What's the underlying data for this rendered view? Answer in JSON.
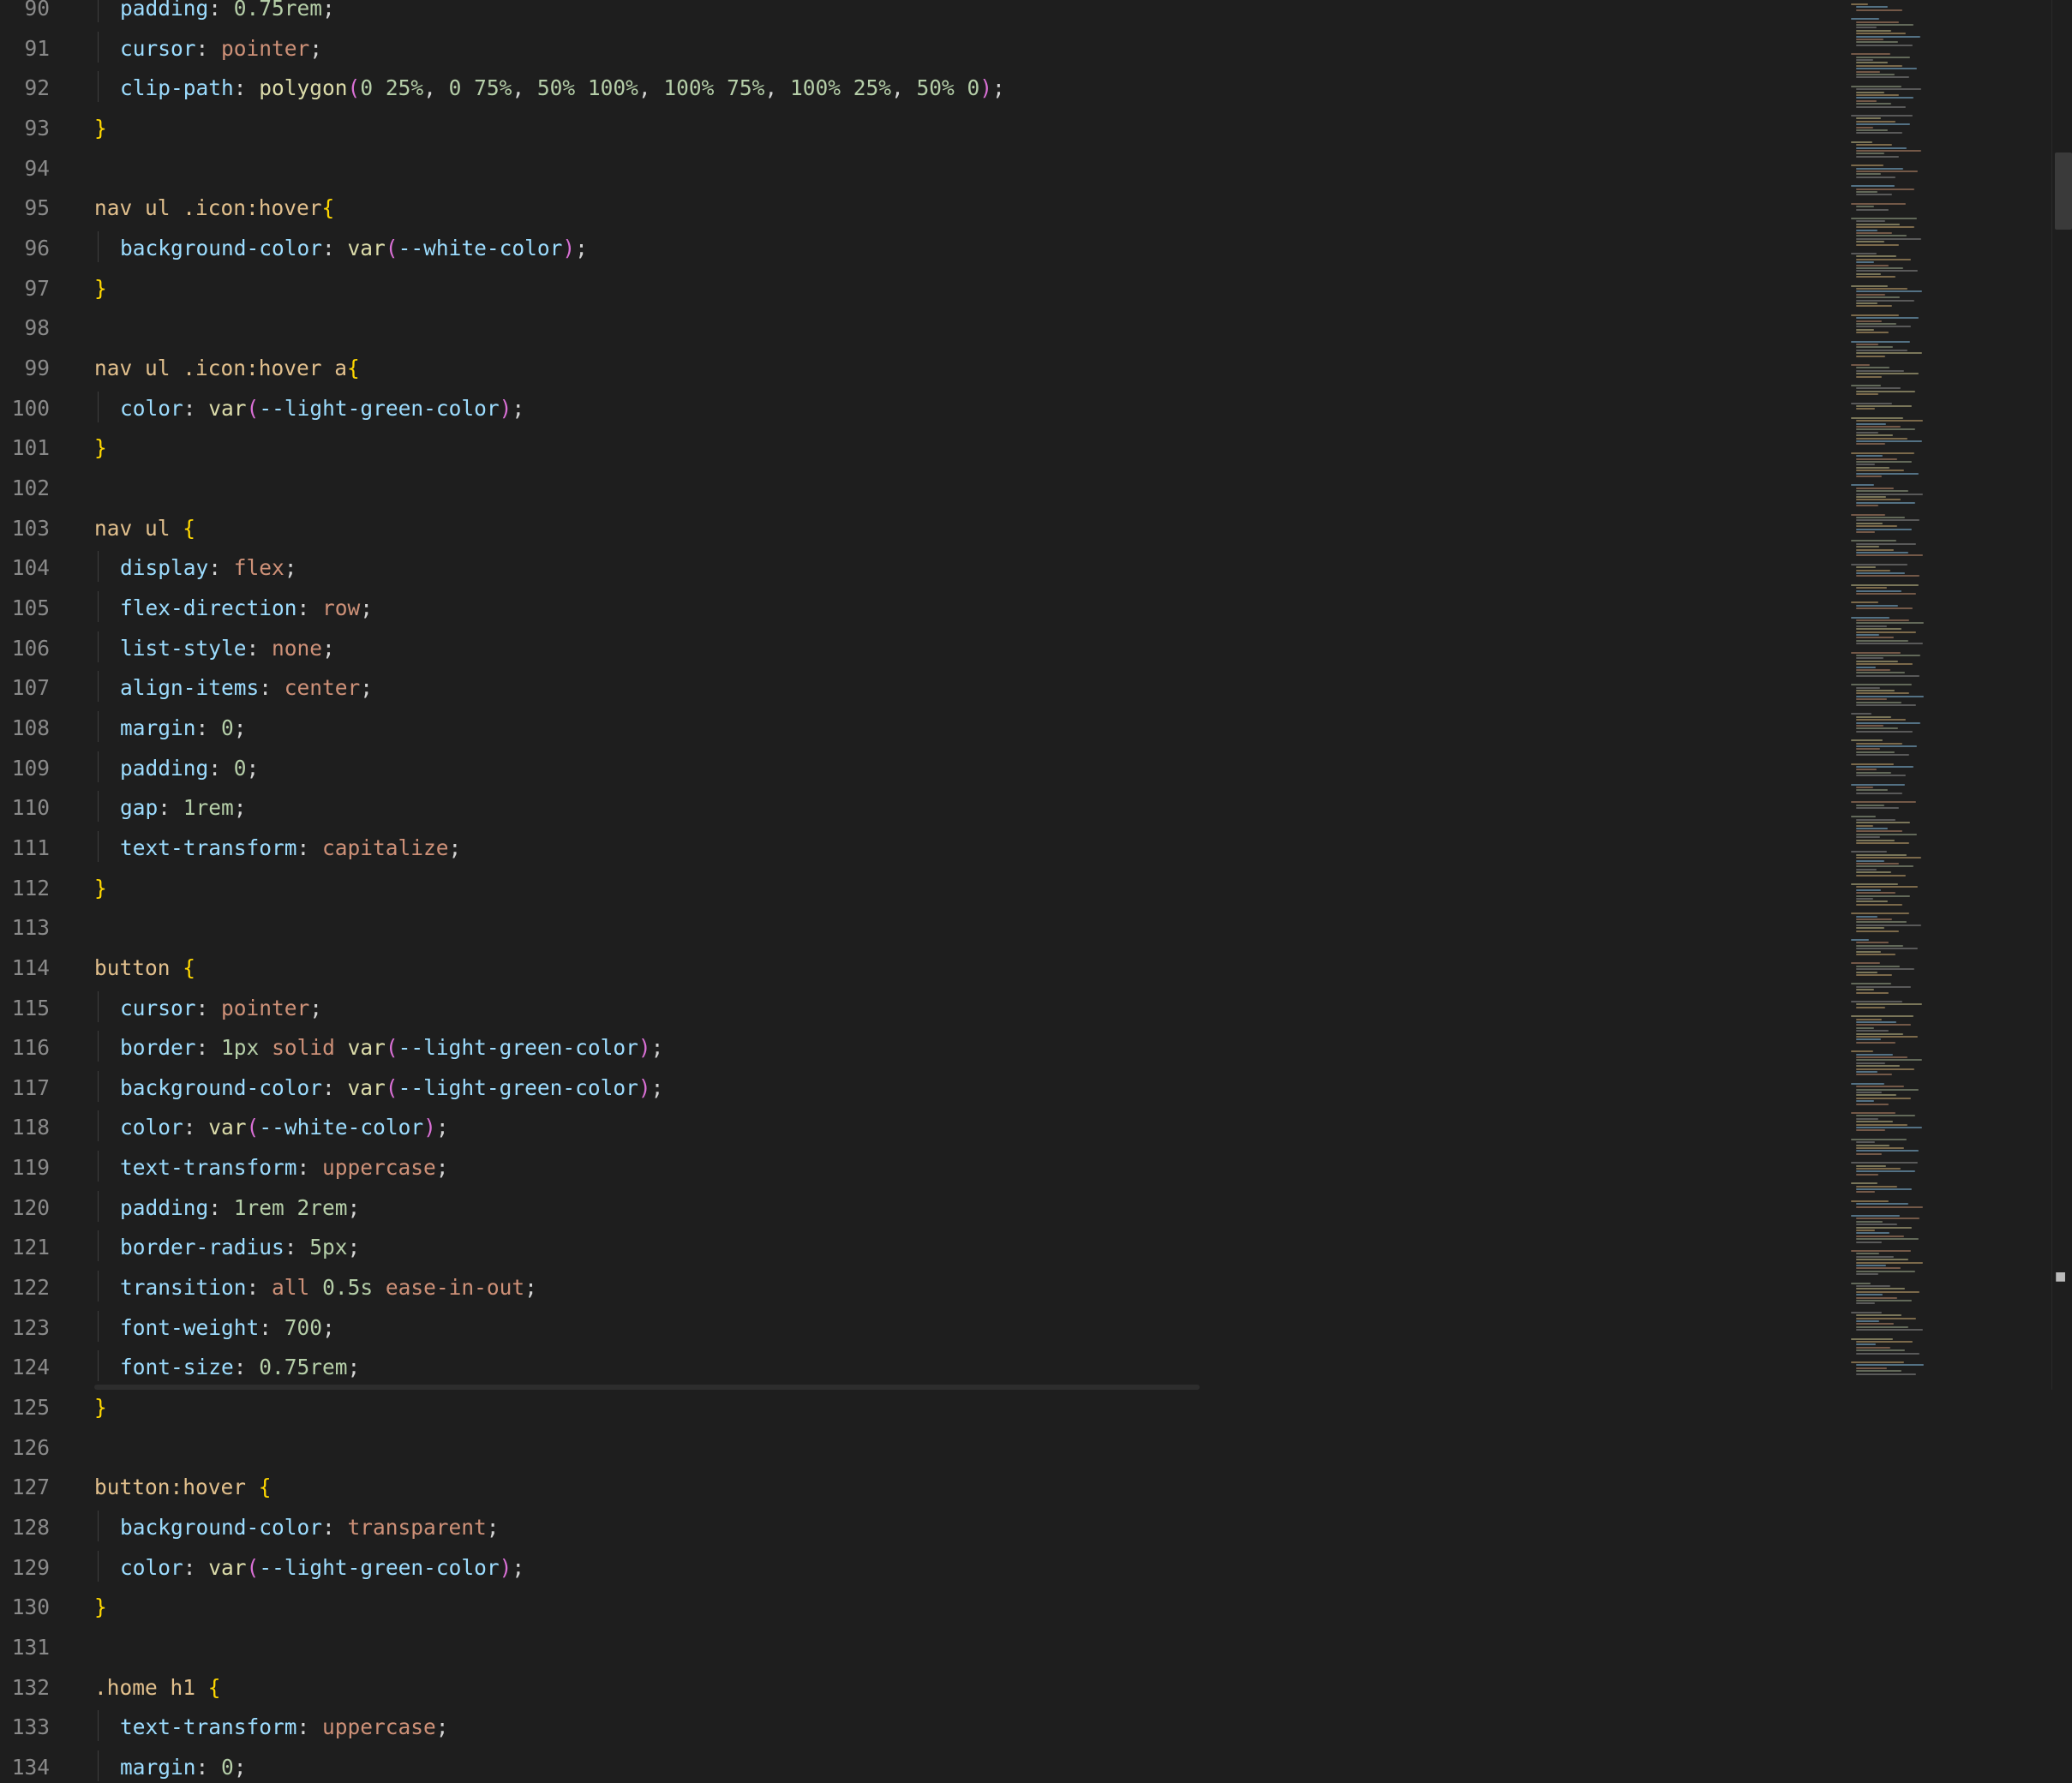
{
  "editor": {
    "language": "css",
    "lines": [
      {
        "n": "90",
        "indent": true,
        "tokens": [
          [
            "prop",
            "padding"
          ],
          [
            "pun",
            ": "
          ],
          [
            "num",
            "0.75rem"
          ],
          [
            "pun",
            ";"
          ]
        ]
      },
      {
        "n": "91",
        "indent": true,
        "tokens": [
          [
            "prop",
            "cursor"
          ],
          [
            "pun",
            ": "
          ],
          [
            "kw",
            "pointer"
          ],
          [
            "pun",
            ";"
          ]
        ]
      },
      {
        "n": "92",
        "indent": true,
        "tokens": [
          [
            "prop",
            "clip-path"
          ],
          [
            "pun",
            ": "
          ],
          [
            "fn",
            "polygon"
          ],
          [
            "paren",
            "("
          ],
          [
            "num",
            "0 25%"
          ],
          [
            "pun",
            ", "
          ],
          [
            "num",
            "0 75%"
          ],
          [
            "pun",
            ", "
          ],
          [
            "num",
            "50% 100%"
          ],
          [
            "pun",
            ", "
          ],
          [
            "num",
            "100% 75%"
          ],
          [
            "pun",
            ", "
          ],
          [
            "num",
            "100% 25%"
          ],
          [
            "pun",
            ", "
          ],
          [
            "num",
            "50% 0"
          ],
          [
            "paren",
            ")"
          ],
          [
            "pun",
            ";"
          ]
        ]
      },
      {
        "n": "93",
        "indent": false,
        "tokens": [
          [
            "brace",
            "}"
          ]
        ]
      },
      {
        "n": "94",
        "indent": false,
        "tokens": []
      },
      {
        "n": "95",
        "indent": false,
        "tokens": [
          [
            "sel",
            "nav ul .icon:hover"
          ],
          [
            "brace",
            "{"
          ]
        ]
      },
      {
        "n": "96",
        "indent": true,
        "tokens": [
          [
            "prop",
            "background-color"
          ],
          [
            "pun",
            ": "
          ],
          [
            "fn",
            "var"
          ],
          [
            "paren",
            "("
          ],
          [
            "var",
            "--white-color"
          ],
          [
            "paren",
            ")"
          ],
          [
            "pun",
            ";"
          ]
        ]
      },
      {
        "n": "97",
        "indent": false,
        "tokens": [
          [
            "brace",
            "}"
          ]
        ]
      },
      {
        "n": "98",
        "indent": false,
        "tokens": []
      },
      {
        "n": "99",
        "indent": false,
        "tokens": [
          [
            "sel",
            "nav ul .icon:hover a"
          ],
          [
            "brace",
            "{"
          ]
        ]
      },
      {
        "n": "100",
        "indent": true,
        "tokens": [
          [
            "prop",
            "color"
          ],
          [
            "pun",
            ": "
          ],
          [
            "fn",
            "var"
          ],
          [
            "paren",
            "("
          ],
          [
            "var",
            "--light-green-color"
          ],
          [
            "paren",
            ")"
          ],
          [
            "pun",
            ";"
          ]
        ]
      },
      {
        "n": "101",
        "indent": false,
        "tokens": [
          [
            "brace",
            "}"
          ]
        ]
      },
      {
        "n": "102",
        "indent": false,
        "tokens": []
      },
      {
        "n": "103",
        "indent": false,
        "tokens": [
          [
            "sel",
            "nav ul "
          ],
          [
            "brace",
            "{"
          ]
        ]
      },
      {
        "n": "104",
        "indent": true,
        "tokens": [
          [
            "prop",
            "display"
          ],
          [
            "pun",
            ": "
          ],
          [
            "kw",
            "flex"
          ],
          [
            "pun",
            ";"
          ]
        ]
      },
      {
        "n": "105",
        "indent": true,
        "tokens": [
          [
            "prop",
            "flex-direction"
          ],
          [
            "pun",
            ": "
          ],
          [
            "kw",
            "row"
          ],
          [
            "pun",
            ";"
          ]
        ]
      },
      {
        "n": "106",
        "indent": true,
        "tokens": [
          [
            "prop",
            "list-style"
          ],
          [
            "pun",
            ": "
          ],
          [
            "kw",
            "none"
          ],
          [
            "pun",
            ";"
          ]
        ]
      },
      {
        "n": "107",
        "indent": true,
        "tokens": [
          [
            "prop",
            "align-items"
          ],
          [
            "pun",
            ": "
          ],
          [
            "kw",
            "center"
          ],
          [
            "pun",
            ";"
          ]
        ]
      },
      {
        "n": "108",
        "indent": true,
        "tokens": [
          [
            "prop",
            "margin"
          ],
          [
            "pun",
            ": "
          ],
          [
            "num",
            "0"
          ],
          [
            "pun",
            ";"
          ]
        ]
      },
      {
        "n": "109",
        "indent": true,
        "tokens": [
          [
            "prop",
            "padding"
          ],
          [
            "pun",
            ": "
          ],
          [
            "num",
            "0"
          ],
          [
            "pun",
            ";"
          ]
        ]
      },
      {
        "n": "110",
        "indent": true,
        "tokens": [
          [
            "prop",
            "gap"
          ],
          [
            "pun",
            ": "
          ],
          [
            "num",
            "1rem"
          ],
          [
            "pun",
            ";"
          ]
        ]
      },
      {
        "n": "111",
        "indent": true,
        "tokens": [
          [
            "prop",
            "text-transform"
          ],
          [
            "pun",
            ": "
          ],
          [
            "kw",
            "capitalize"
          ],
          [
            "pun",
            ";"
          ]
        ]
      },
      {
        "n": "112",
        "indent": false,
        "tokens": [
          [
            "brace",
            "}"
          ]
        ]
      },
      {
        "n": "113",
        "indent": false,
        "tokens": []
      },
      {
        "n": "114",
        "indent": false,
        "tokens": [
          [
            "sel",
            "button "
          ],
          [
            "brace",
            "{"
          ]
        ]
      },
      {
        "n": "115",
        "indent": true,
        "tokens": [
          [
            "prop",
            "cursor"
          ],
          [
            "pun",
            ": "
          ],
          [
            "kw",
            "pointer"
          ],
          [
            "pun",
            ";"
          ]
        ]
      },
      {
        "n": "116",
        "indent": true,
        "tokens": [
          [
            "prop",
            "border"
          ],
          [
            "pun",
            ": "
          ],
          [
            "num",
            "1px"
          ],
          [
            "pun",
            " "
          ],
          [
            "kw",
            "solid"
          ],
          [
            "pun",
            " "
          ],
          [
            "fn",
            "var"
          ],
          [
            "paren",
            "("
          ],
          [
            "var",
            "--light-green-color"
          ],
          [
            "paren",
            ")"
          ],
          [
            "pun",
            ";"
          ]
        ]
      },
      {
        "n": "117",
        "indent": true,
        "tokens": [
          [
            "prop",
            "background-color"
          ],
          [
            "pun",
            ": "
          ],
          [
            "fn",
            "var"
          ],
          [
            "paren",
            "("
          ],
          [
            "var",
            "--light-green-color"
          ],
          [
            "paren",
            ")"
          ],
          [
            "pun",
            ";"
          ]
        ]
      },
      {
        "n": "118",
        "indent": true,
        "tokens": [
          [
            "prop",
            "color"
          ],
          [
            "pun",
            ": "
          ],
          [
            "fn",
            "var"
          ],
          [
            "paren",
            "("
          ],
          [
            "var",
            "--white-color"
          ],
          [
            "paren",
            ")"
          ],
          [
            "pun",
            ";"
          ]
        ]
      },
      {
        "n": "119",
        "indent": true,
        "tokens": [
          [
            "prop",
            "text-transform"
          ],
          [
            "pun",
            ": "
          ],
          [
            "kw",
            "uppercase"
          ],
          [
            "pun",
            ";"
          ]
        ]
      },
      {
        "n": "120",
        "indent": true,
        "tokens": [
          [
            "prop",
            "padding"
          ],
          [
            "pun",
            ": "
          ],
          [
            "num",
            "1rem 2rem"
          ],
          [
            "pun",
            ";"
          ]
        ]
      },
      {
        "n": "121",
        "indent": true,
        "tokens": [
          [
            "prop",
            "border-radius"
          ],
          [
            "pun",
            ": "
          ],
          [
            "num",
            "5px"
          ],
          [
            "pun",
            ";"
          ]
        ]
      },
      {
        "n": "122",
        "indent": true,
        "tokens": [
          [
            "prop",
            "transition"
          ],
          [
            "pun",
            ": "
          ],
          [
            "kw",
            "all"
          ],
          [
            "pun",
            " "
          ],
          [
            "num",
            "0.5s"
          ],
          [
            "pun",
            " "
          ],
          [
            "kw",
            "ease-in-out"
          ],
          [
            "pun",
            ";"
          ]
        ]
      },
      {
        "n": "123",
        "indent": true,
        "tokens": [
          [
            "prop",
            "font-weight"
          ],
          [
            "pun",
            ": "
          ],
          [
            "num",
            "700"
          ],
          [
            "pun",
            ";"
          ]
        ]
      },
      {
        "n": "124",
        "indent": true,
        "tokens": [
          [
            "prop",
            "font-size"
          ],
          [
            "pun",
            ": "
          ],
          [
            "num",
            "0.75rem"
          ],
          [
            "pun",
            ";"
          ]
        ]
      },
      {
        "n": "125",
        "indent": false,
        "tokens": [
          [
            "brace",
            "}"
          ]
        ]
      },
      {
        "n": "126",
        "indent": false,
        "tokens": []
      },
      {
        "n": "127",
        "indent": false,
        "tokens": [
          [
            "sel",
            "button:hover "
          ],
          [
            "brace",
            "{"
          ]
        ]
      },
      {
        "n": "128",
        "indent": true,
        "tokens": [
          [
            "prop",
            "background-color"
          ],
          [
            "pun",
            ": "
          ],
          [
            "kw",
            "transparent"
          ],
          [
            "pun",
            ";"
          ]
        ]
      },
      {
        "n": "129",
        "indent": true,
        "tokens": [
          [
            "prop",
            "color"
          ],
          [
            "pun",
            ": "
          ],
          [
            "fn",
            "var"
          ],
          [
            "paren",
            "("
          ],
          [
            "var",
            "--light-green-color"
          ],
          [
            "paren",
            ")"
          ],
          [
            "pun",
            ";"
          ]
        ]
      },
      {
        "n": "130",
        "indent": false,
        "tokens": [
          [
            "brace",
            "}"
          ]
        ]
      },
      {
        "n": "131",
        "indent": false,
        "tokens": []
      },
      {
        "n": "132",
        "indent": false,
        "tokens": [
          [
            "sel",
            ".home h1 "
          ],
          [
            "brace",
            "{"
          ]
        ]
      },
      {
        "n": "133",
        "indent": true,
        "tokens": [
          [
            "prop",
            "text-transform"
          ],
          [
            "pun",
            ": "
          ],
          [
            "kw",
            "uppercase"
          ],
          [
            "pun",
            ";"
          ]
        ]
      },
      {
        "n": "134",
        "indent": true,
        "tokens": [
          [
            "prop",
            "margin"
          ],
          [
            "pun",
            ": "
          ],
          [
            "num",
            "0"
          ],
          [
            "pun",
            ";"
          ]
        ]
      }
    ]
  },
  "colors": {
    "background": "#1e1e1e",
    "selector": "#e2c08d",
    "property": "#9cdcfe",
    "number": "#b5cea8",
    "keyword": "#ce9178",
    "function": "#dcdcaa",
    "brace": "#ffd700",
    "paren": "#da70d6"
  },
  "scrollbar": {
    "marker_icon": "overview-ruler-marker-icon"
  }
}
